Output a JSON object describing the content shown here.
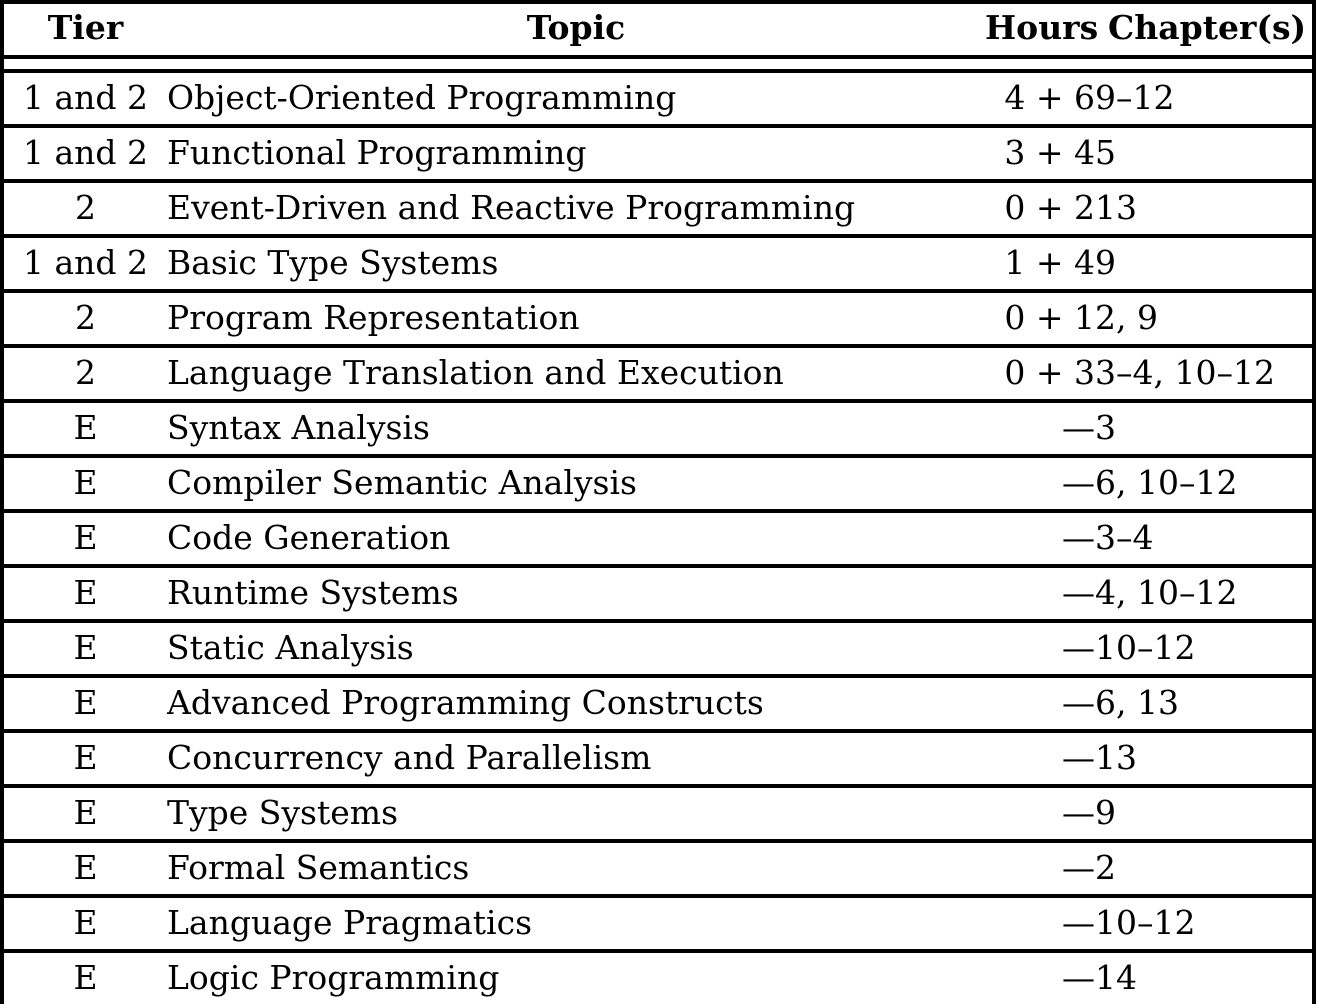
{
  "table": {
    "columns": [
      {
        "key": "tier",
        "label": "Tier",
        "align": "center"
      },
      {
        "key": "topic",
        "label": "Topic",
        "align": "center"
      },
      {
        "key": "hours",
        "label": "Hours",
        "align": "right"
      },
      {
        "key": "chapter",
        "label": "Chapter(s)",
        "align": "left"
      }
    ],
    "rows": [
      {
        "tier": "1 and 2",
        "topic": "Object-Oriented Programming",
        "hours": "4 + 6",
        "chapter": "9–12"
      },
      {
        "tier": "1 and 2",
        "topic": "Functional Programming",
        "hours": "3 + 4",
        "chapter": "5"
      },
      {
        "tier": "2",
        "topic": "Event-Driven and Reactive Programming",
        "hours": "0 + 2",
        "chapter": "13"
      },
      {
        "tier": "1 and 2",
        "topic": "Basic Type Systems",
        "hours": "1 + 4",
        "chapter": "9"
      },
      {
        "tier": "2",
        "topic": "Program Representation",
        "hours": "0 + 1",
        "chapter": "2, 9"
      },
      {
        "tier": "2",
        "topic": "Language Translation and Execution",
        "hours": "0 + 3",
        "chapter": "3–4, 10–12"
      },
      {
        "tier": "E",
        "topic": "Syntax Analysis",
        "hours": "—",
        "chapter": "3"
      },
      {
        "tier": "E",
        "topic": "Compiler Semantic Analysis",
        "hours": "—",
        "chapter": "6, 10–12"
      },
      {
        "tier": "E",
        "topic": "Code Generation",
        "hours": "—",
        "chapter": "3–4"
      },
      {
        "tier": "E",
        "topic": "Runtime Systems",
        "hours": "—",
        "chapter": "4, 10–12"
      },
      {
        "tier": "E",
        "topic": "Static Analysis",
        "hours": "—",
        "chapter": "10–12"
      },
      {
        "tier": "E",
        "topic": "Advanced Programming Constructs",
        "hours": "—",
        "chapter": "6, 13"
      },
      {
        "tier": "E",
        "topic": "Concurrency and Parallelism",
        "hours": "—",
        "chapter": "13"
      },
      {
        "tier": "E",
        "topic": "Type Systems",
        "hours": "—",
        "chapter": "9"
      },
      {
        "tier": "E",
        "topic": "Formal Semantics",
        "hours": "—",
        "chapter": "2"
      },
      {
        "tier": "E",
        "topic": "Language Pragmatics",
        "hours": "—",
        "chapter": "10–12"
      },
      {
        "tier": "E",
        "topic": "Logic Programming",
        "hours": "—",
        "chapter": "14"
      }
    ]
  },
  "style": {
    "rule_color": "#000000",
    "background": "#ffffff",
    "text_color": "#000000"
  }
}
